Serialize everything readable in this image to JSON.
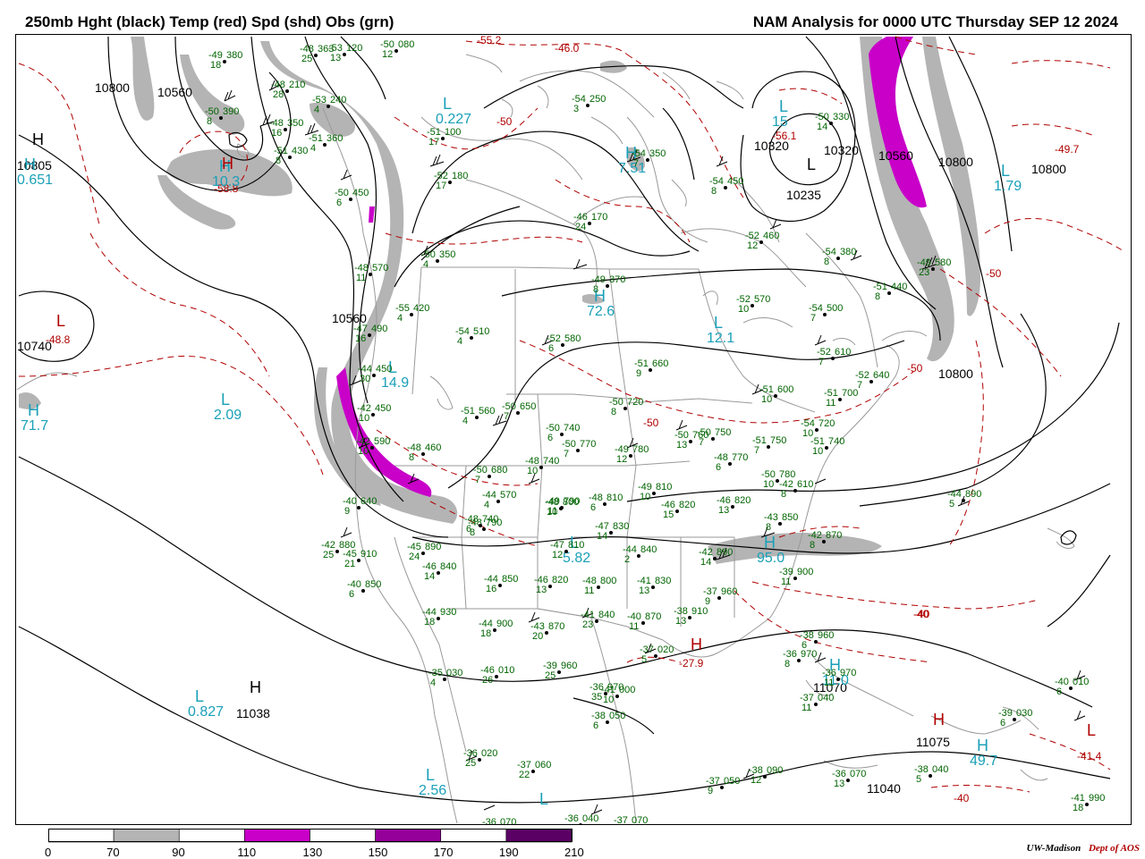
{
  "header": {
    "left": "250mb Hght (black) Temp (red) Spd (shd) Obs (grn)",
    "right": "NAM Analysis for 0000 UTC Thursday  SEP 12 2024"
  },
  "colors": {
    "height_contour": "#000000",
    "temperature_contour": "#b00000",
    "observations": "#006400",
    "pressure_centers": "#1aa0b8",
    "coastlines_borders": "#9a9a9a",
    "speed_70_90": "#b4b4b4",
    "speed_110_130": "#c800c8",
    "speed_150_170": "#96009a",
    "speed_190_210": "#5a0064"
  },
  "legend": {
    "ticks": [
      "0",
      "70",
      "90",
      "110",
      "130",
      "150",
      "170",
      "190",
      "210"
    ],
    "segments": [
      {
        "from": "0",
        "to": "70",
        "color": "#ffffff"
      },
      {
        "from": "70",
        "to": "90",
        "color": "#b4b4b4"
      },
      {
        "from": "90",
        "to": "110",
        "color": "#ffffff"
      },
      {
        "from": "110",
        "to": "130",
        "color": "#c800c8"
      },
      {
        "from": "130",
        "to": "150",
        "color": "#ffffff"
      },
      {
        "from": "150",
        "to": "170",
        "color": "#96009a"
      },
      {
        "from": "170",
        "to": "190",
        "color": "#ffffff"
      },
      {
        "from": "190",
        "to": "210",
        "color": "#5a0064"
      }
    ]
  },
  "credit": {
    "org": "UW-Madison",
    "dept": "Dept of AOS"
  },
  "height_labels": [
    "10800",
    "10560",
    "10320",
    "10320",
    "10560",
    "10800",
    "10800",
    "10800",
    "10560",
    "10235",
    "10805",
    "10740",
    "11038",
    "11070",
    "11075",
    "11040"
  ],
  "temperature_labels": [
    "-55.2",
    "-46.0",
    "-50",
    "-50",
    "-56.1",
    "-49.7",
    "-58.8",
    "-48.8",
    "-50",
    "-50",
    "-40",
    "-40",
    "-40",
    "-41.4",
    "-27.9"
  ],
  "centers": [
    {
      "type": "H",
      "value": "",
      "color": "black"
    },
    {
      "type": "H",
      "value": "0.651",
      "color": "cyan"
    },
    {
      "type": "H",
      "value": "10.3",
      "color": "cyan"
    },
    {
      "type": "L",
      "value": "0.227",
      "color": "cyan"
    },
    {
      "type": "H",
      "value": "7.51",
      "color": "cyan"
    },
    {
      "type": "L",
      "value": "1.79",
      "color": "cyan"
    },
    {
      "type": "L",
      "value": "15",
      "color": "cyan"
    },
    {
      "type": "L",
      "value": "",
      "color": "black"
    },
    {
      "type": "H",
      "value": "72.6",
      "color": "cyan"
    },
    {
      "type": "L",
      "value": "12.1",
      "color": "cyan"
    },
    {
      "type": "L",
      "value": "14.9",
      "color": "cyan"
    },
    {
      "type": "L",
      "value": "2.09",
      "color": "cyan"
    },
    {
      "type": "H",
      "value": "71.7",
      "color": "cyan"
    },
    {
      "type": "L",
      "value": "5.82",
      "color": "cyan"
    },
    {
      "type": "H",
      "value": "95.0",
      "color": "cyan"
    },
    {
      "type": "L",
      "value": "0.827",
      "color": "cyan"
    },
    {
      "type": "L",
      "value": "2.56",
      "color": "cyan"
    },
    {
      "type": "H",
      "value": "49.7",
      "color": "cyan"
    },
    {
      "type": "H",
      "value": "11.0",
      "color": "cyan"
    },
    {
      "type": "L",
      "value": "",
      "color": "cyan"
    },
    {
      "type": "H",
      "value": "",
      "color": "red"
    },
    {
      "type": "L",
      "value": "",
      "color": "red"
    },
    {
      "type": "H",
      "value": "",
      "color": "red"
    },
    {
      "type": "L",
      "value": "",
      "color": "red"
    },
    {
      "type": "H",
      "value": "",
      "color": "black"
    },
    {
      "type": "H",
      "value": "",
      "color": "red"
    }
  ],
  "observations": [
    {
      "t": "-49",
      "h": "380",
      "d": "18"
    },
    {
      "t": "-48",
      "h": "363",
      "d": "25"
    },
    {
      "t": "-53",
      "h": "120",
      "d": "13"
    },
    {
      "t": "-50",
      "h": "080",
      "d": "12"
    },
    {
      "t": "-50",
      "h": "390",
      "d": "8"
    },
    {
      "t": "-48",
      "h": "210",
      "d": "28"
    },
    {
      "t": "-53",
      "h": "240",
      "d": "4"
    },
    {
      "t": "-48",
      "h": "350",
      "d": "16"
    },
    {
      "t": "-51",
      "h": "430",
      "d": "8"
    },
    {
      "t": "-51",
      "h": "360",
      "d": "4"
    },
    {
      "t": "-50",
      "h": "450",
      "d": "6"
    },
    {
      "t": "-51",
      "h": "100",
      "d": "17"
    },
    {
      "t": "-52",
      "h": "180",
      "d": "17"
    },
    {
      "t": "-54",
      "h": "250",
      "d": "3"
    },
    {
      "t": "-54",
      "h": "350",
      "d": "7"
    },
    {
      "t": "-46",
      "h": "170",
      "d": "24"
    },
    {
      "t": "-54",
      "h": "450",
      "d": "8"
    },
    {
      "t": "-50",
      "h": "330",
      "d": "14"
    },
    {
      "t": "-52",
      "h": "460",
      "d": "12"
    },
    {
      "t": "-54",
      "h": "380",
      "d": "8"
    },
    {
      "t": "-49",
      "h": "580",
      "d": "23"
    },
    {
      "t": "-51",
      "h": "440",
      "d": "8"
    },
    {
      "t": "-50",
      "h": "350",
      "d": "4"
    },
    {
      "t": "-48",
      "h": "570",
      "d": "11"
    },
    {
      "t": "-49",
      "h": "370",
      "d": "8"
    },
    {
      "t": "-55",
      "h": "420",
      "d": "4"
    },
    {
      "t": "-52",
      "h": "570",
      "d": "10"
    },
    {
      "t": "-54",
      "h": "500",
      "d": "7"
    },
    {
      "t": "-47",
      "h": "490",
      "d": "16"
    },
    {
      "t": "-54",
      "h": "510",
      "d": "4"
    },
    {
      "t": "-52",
      "h": "580",
      "d": "6"
    },
    {
      "t": "-52",
      "h": "610",
      "d": "7"
    },
    {
      "t": "-44",
      "h": "450",
      "d": "30"
    },
    {
      "t": "-51",
      "h": "660",
      "d": "9"
    },
    {
      "t": "-52",
      "h": "640",
      "d": "7"
    },
    {
      "t": "-42",
      "h": "450",
      "d": "10"
    },
    {
      "t": "-51",
      "h": "560",
      "d": "4"
    },
    {
      "t": "-50",
      "h": "650",
      "d": "7"
    },
    {
      "t": "-50",
      "h": "720",
      "d": "8"
    },
    {
      "t": "-51",
      "h": "600",
      "d": "10"
    },
    {
      "t": "-51",
      "h": "700",
      "d": "11"
    },
    {
      "t": "-42",
      "h": "590",
      "d": "10"
    },
    {
      "t": "-50",
      "h": "740",
      "d": "6"
    },
    {
      "t": "-54",
      "h": "720",
      "d": "10"
    },
    {
      "t": "-48",
      "h": "460",
      "d": "8"
    },
    {
      "t": "-50",
      "h": "770",
      "d": "7"
    },
    {
      "t": "-49",
      "h": "780",
      "d": "12"
    },
    {
      "t": "-50",
      "h": "760",
      "d": "13"
    },
    {
      "t": "-50",
      "h": "750",
      "d": "7"
    },
    {
      "t": "-51",
      "h": "750",
      "d": "7"
    },
    {
      "t": "-51",
      "h": "740",
      "d": "10"
    },
    {
      "t": "-48",
      "h": "770",
      "d": "6"
    },
    {
      "t": "-50",
      "h": "680",
      "d": "7"
    },
    {
      "t": "-48",
      "h": "740",
      "d": "10"
    },
    {
      "t": "-49",
      "h": "810",
      "d": "10"
    },
    {
      "t": "-50",
      "h": "780",
      "d": "10"
    },
    {
      "t": "-49",
      "h": "790",
      "d": "11"
    },
    {
      "t": "-42",
      "h": "610",
      "d": "8"
    },
    {
      "t": "-44",
      "h": "570",
      "d": "4"
    },
    {
      "t": "-48",
      "h": "790",
      "d": "8"
    },
    {
      "t": "-48",
      "h": "800",
      "d": "10"
    },
    {
      "t": "-48",
      "h": "810",
      "d": "6"
    },
    {
      "t": "-46",
      "h": "820",
      "d": "15"
    },
    {
      "t": "-46",
      "h": "820",
      "d": "13"
    },
    {
      "t": "-44",
      "h": "890",
      "d": "5"
    },
    {
      "t": "-40",
      "h": "640",
      "d": "9"
    },
    {
      "t": "-48",
      "h": "740",
      "d": "6"
    },
    {
      "t": "-47",
      "h": "830",
      "d": "14"
    },
    {
      "t": "-47",
      "h": "810",
      "d": "12"
    },
    {
      "t": "-44",
      "h": "840",
      "d": "2"
    },
    {
      "t": "-43",
      "h": "850",
      "d": "8"
    },
    {
      "t": "-42",
      "h": "870",
      "d": "8"
    },
    {
      "t": "-42",
      "h": "880",
      "d": "25"
    },
    {
      "t": "-45",
      "h": "910",
      "d": "21"
    },
    {
      "t": "-45",
      "h": "890",
      "d": "24"
    },
    {
      "t": "-46",
      "h": "840",
      "d": "14"
    },
    {
      "t": "-44",
      "h": "850",
      "d": "16"
    },
    {
      "t": "-46",
      "h": "820",
      "d": "13"
    },
    {
      "t": "-48",
      "h": "800",
      "d": "11"
    },
    {
      "t": "-41",
      "h": "830",
      "d": "13"
    },
    {
      "t": "-42",
      "h": "890",
      "d": "14"
    },
    {
      "t": "-39",
      "h": "900",
      "d": "11"
    },
    {
      "t": "-40",
      "h": "850",
      "d": "6"
    },
    {
      "t": "-44",
      "h": "930",
      "d": "18"
    },
    {
      "t": "-44",
      "h": "900",
      "d": "18"
    },
    {
      "t": "-43",
      "h": "870",
      "d": "20"
    },
    {
      "t": "-41",
      "h": "840",
      "d": "23"
    },
    {
      "t": "-40",
      "h": "870",
      "d": "11"
    },
    {
      "t": "-38",
      "h": "910",
      "d": "13"
    },
    {
      "t": "-37",
      "h": "960",
      "d": "9"
    },
    {
      "t": "-38",
      "h": "960",
      "d": "6"
    },
    {
      "t": "-37",
      "h": "020",
      "d": "5"
    },
    {
      "t": "-36",
      "h": "970",
      "d": "8"
    },
    {
      "t": "-35",
      "h": "030",
      "d": "4"
    },
    {
      "t": "-46",
      "h": "010",
      "d": "26"
    },
    {
      "t": "-39",
      "h": "960",
      "d": "25"
    },
    {
      "t": "-36",
      "h": "970",
      "d": "35"
    },
    {
      "t": "-36",
      "h": "970",
      "d": "11"
    },
    {
      "t": "-37",
      "h": "040",
      "d": "11"
    },
    {
      "t": "-38",
      "h": "050",
      "d": "6"
    },
    {
      "t": "-36",
      "h": "020",
      "d": "25"
    },
    {
      "t": "-37",
      "h": "060",
      "d": "22"
    },
    {
      "t": "-37",
      "h": "050",
      "d": "9"
    },
    {
      "t": "-38",
      "h": "090",
      "d": "12"
    },
    {
      "t": "-36",
      "h": "070",
      "d": "13"
    },
    {
      "t": "-38",
      "h": "040",
      "d": "5"
    },
    {
      "t": "-39",
      "h": "030",
      "d": "6"
    },
    {
      "t": "-40",
      "h": "010",
      "d": "6"
    },
    {
      "t": "-41",
      "h": "990",
      "d": "18"
    },
    {
      "t": "-41",
      "h": "000",
      "d": "10"
    },
    {
      "t": "-36",
      "h": "070",
      "d": "16"
    },
    {
      "t": "-36",
      "h": "040",
      "d": "12"
    },
    {
      "t": "-37",
      "h": "070",
      "d": "12"
    },
    {
      "t": "-37",
      "h": "070",
      "d": "11"
    }
  ]
}
